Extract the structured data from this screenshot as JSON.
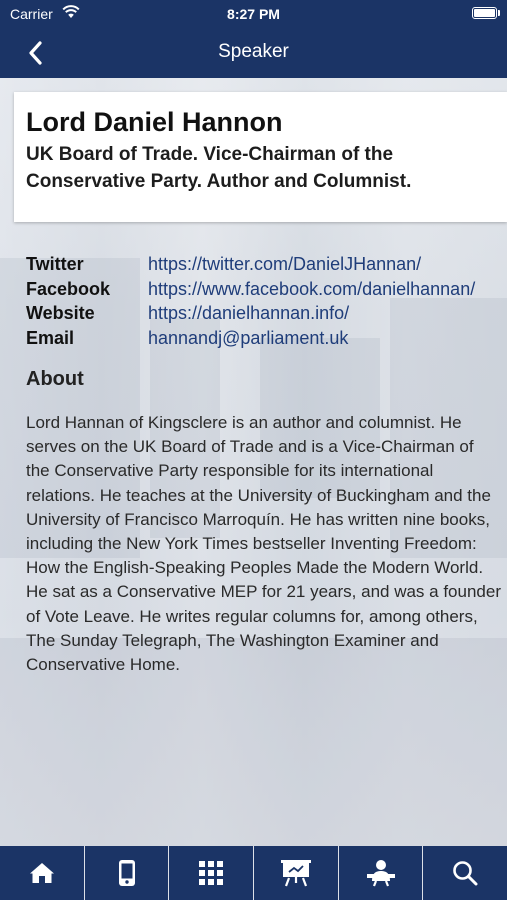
{
  "status": {
    "carrier": "Carrier",
    "time": "8:27 PM"
  },
  "nav": {
    "title": "Speaker",
    "back_icon": "chevron-left-icon"
  },
  "speaker": {
    "name": "Lord Daniel Hannon",
    "role": "UK Board of Trade. Vice-Chairman of the Conservative Party. Author and Columnist."
  },
  "contacts": [
    {
      "label": "Twitter",
      "value": "https://twitter.com/DanielJHannan/"
    },
    {
      "label": "Facebook",
      "value": "https://www.facebook.com/danielhannan/"
    },
    {
      "label": "Website",
      "value": "https://danielhannan.info/"
    },
    {
      "label": "Email",
      "value": "hannandj@parliament.uk"
    }
  ],
  "about": {
    "heading": "About",
    "text": "Lord Hannan of Kingsclere is an author and columnist. He serves on the UK Board of Trade and is a Vice-Chairman of the Conservative Party responsible for its international relations. He teaches at the University of Buckingham and the University of Francisco Marroquín. He has written nine books, including the New York Times bestseller Inventing Freedom: How the English-Speaking Peoples Made the Modern World. He sat as a Conservative MEP for 21 years, and was a founder of Vote Leave. He writes regular columns for, among others, The Sunday Telegraph, The Washington Examiner and Conservative Home."
  },
  "tabbar": {
    "icons": [
      "home-icon",
      "mobile-icon",
      "grid-icon",
      "presentation-icon",
      "speaker-icon",
      "search-icon"
    ]
  },
  "colors": {
    "brand": "#1b3466",
    "link": "#1f3d7a"
  }
}
